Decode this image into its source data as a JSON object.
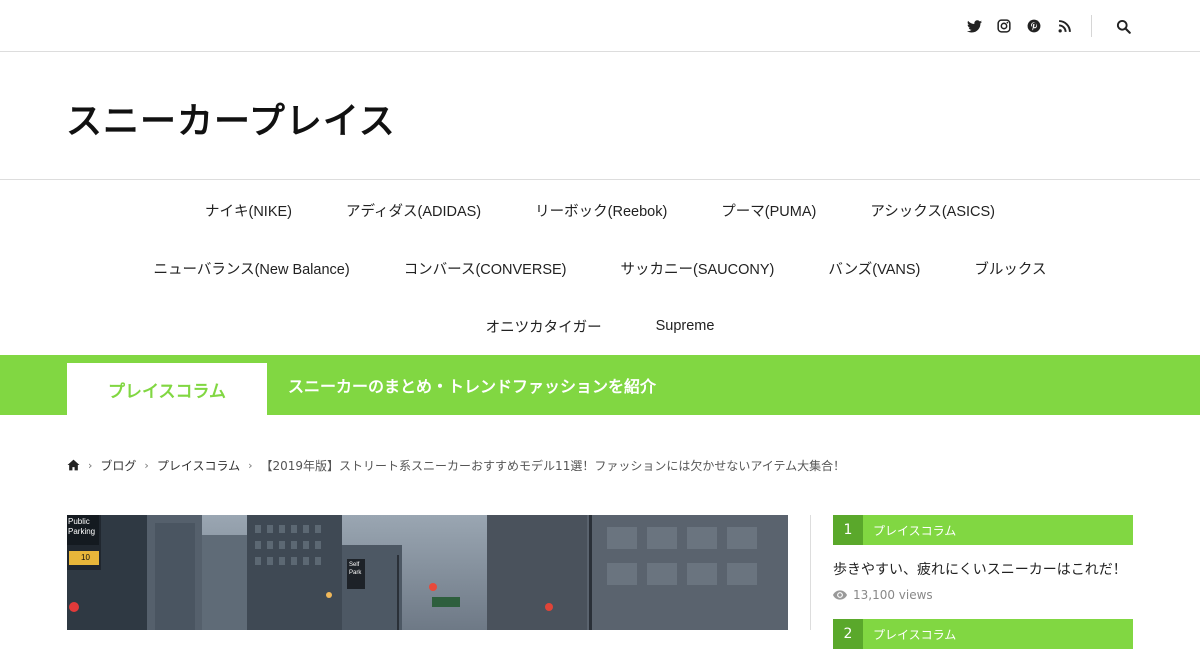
{
  "topbar": {
    "icons": [
      "twitter-icon",
      "instagram-icon",
      "pinterest-icon",
      "rss-icon",
      "search-icon"
    ]
  },
  "header": {
    "site_title": "スニーカープレイス"
  },
  "nav": {
    "row1": [
      "ナイキ(NIKE)",
      "アディダス(ADIDAS)",
      "リーボック(Reebok)",
      "プーマ(PUMA)",
      "アシックス(ASICS)"
    ],
    "row2": [
      "ニューバランス(New Balance)",
      "コンバース(CONVERSE)",
      "サッカニー(SAUCONY)",
      "バンズ(VANS)",
      "ブルックス"
    ],
    "row3": [
      "オニツカタイガー",
      "Supreme"
    ]
  },
  "category": {
    "name": "プレイスコラム",
    "description": "スニーカーのまとめ・トレンドファッションを紹介"
  },
  "breadcrumb": {
    "home_icon": "home-icon",
    "items": [
      "ブログ",
      "プレイスコラム"
    ],
    "current": "【2019年版】ストリート系スニーカーおすすめモデル11選！ファッションには欠かせないアイテム大集合！"
  },
  "hero": {
    "signs": [
      "Public",
      "Parking",
      "10",
      "Self",
      "Park"
    ]
  },
  "ranking": [
    {
      "rank": "1",
      "category": "プレイスコラム",
      "title": "歩きやすい、疲れにくいスニーカーはこれだ！",
      "views": "13,100 views"
    },
    {
      "rank": "2",
      "category": "プレイスコラム"
    }
  ],
  "colors": {
    "accent": "#81d742",
    "accent_dark": "#5aa82b"
  }
}
